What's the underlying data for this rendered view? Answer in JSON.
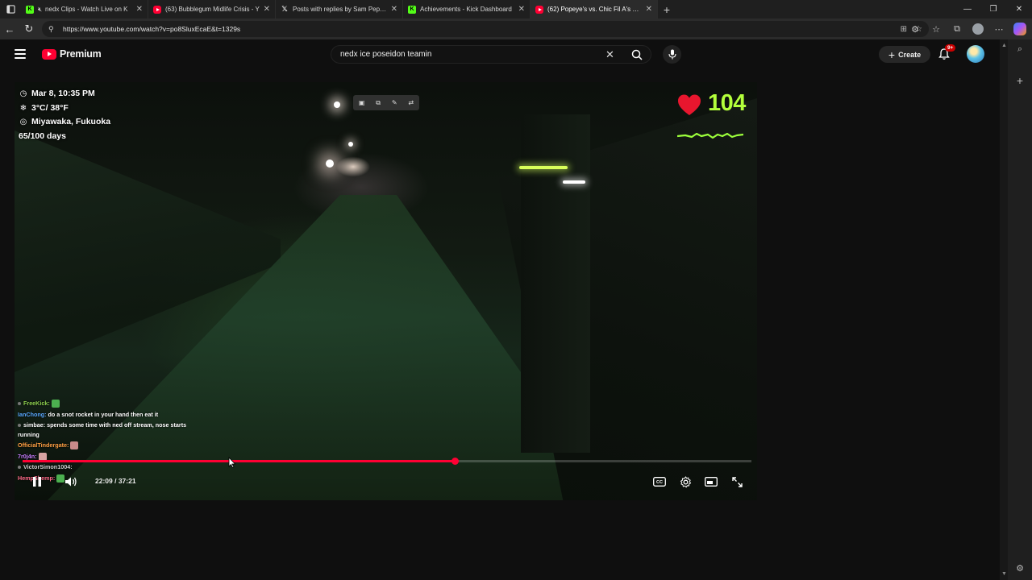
{
  "browser": {
    "tabs": [
      {
        "title": "nedx Clips - Watch Live on K",
        "favicon": "kick",
        "muted": true,
        "active": false
      },
      {
        "title": "(63) Bubblegum Midlife Crisis - Y",
        "favicon": "youtube",
        "muted": false,
        "active": false
      },
      {
        "title": "Posts with replies by Sam Pepper",
        "favicon": "x",
        "muted": false,
        "active": false
      },
      {
        "title": "Achievements - Kick Dashboard",
        "favicon": "kick",
        "muted": false,
        "active": false
      },
      {
        "title": "(62) Popeye's vs. Chic Fil A's Spic",
        "favicon": "youtube",
        "muted": false,
        "active": true
      }
    ],
    "url": "https://www.youtube.com/watch?v=po8SluxEcaE&t=1329s"
  },
  "youtube": {
    "logo_text": "Premium",
    "search_value": "nedx ice poseidon teamin",
    "create_label": "Create",
    "notification_badge": "9+"
  },
  "video": {
    "overlay": {
      "datetime": "Mar 8, 10:35 PM",
      "weather": "3°C/ 38°F",
      "location": "Miyawaka, Fukuoka",
      "days": "65/100 days"
    },
    "heart_rate": "104",
    "chat": [
      {
        "user": "FreeKick:",
        "text": "",
        "user_color": "#8fd14f",
        "emote": "#4caf50",
        "badge": true
      },
      {
        "user": "IanChong:",
        "text": "do a snot rocket in your hand then eat it",
        "user_color": "#5aa9ff",
        "emote": "",
        "badge": false
      },
      {
        "user": "simbae:",
        "text": "spends some time with ned off stream, nose starts running",
        "user_color": "#ffffff",
        "emote": "",
        "badge": true
      },
      {
        "user": "OfficialTindergate:",
        "text": "",
        "user_color": "#ff9f43",
        "emote": "#c98a8a",
        "badge": false
      },
      {
        "user": "7r0j4n:",
        "text": "",
        "user_color": "#c77dff",
        "emote": "#d7a3a3",
        "badge": false
      },
      {
        "user": "VictorSimon1004:",
        "text": "",
        "user_color": "#cfcfcf",
        "emote": "",
        "badge": true
      },
      {
        "user": "HempShemp:",
        "text": "",
        "user_color": "#ff6b8a",
        "emote": "#4caf50",
        "badge": false
      }
    ],
    "current_time": "22:09",
    "duration": "37:21",
    "time_display": "22:09 / 37:21",
    "played_fraction": 0.593,
    "loaded_fraction": 0.593,
    "accent_color": "#ff0033"
  }
}
